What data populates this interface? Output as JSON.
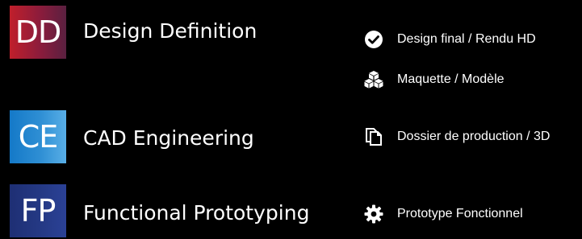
{
  "sections": [
    {
      "abbr": "DD",
      "title": "Design Definition"
    },
    {
      "abbr": "CE",
      "title": "CAD Engineering"
    },
    {
      "abbr": "FP",
      "title": "Functional Prototyping"
    }
  ],
  "deliverables": [
    {
      "icon": "check-circle-icon",
      "label": "Design final / Rendu HD"
    },
    {
      "icon": "cubes-icon",
      "label": "Maquette / Modèle"
    },
    {
      "icon": "copy-documents-icon",
      "label": "Dossier de production / 3D"
    },
    {
      "icon": "gear-icon",
      "label": "Prototype Fonctionnel"
    }
  ],
  "colors": {
    "background": "#000000",
    "dd_badge": "#a01e34",
    "ce_badge": "#2a8ad2",
    "fp_badge": "#253a86",
    "text": "#ffffff"
  }
}
